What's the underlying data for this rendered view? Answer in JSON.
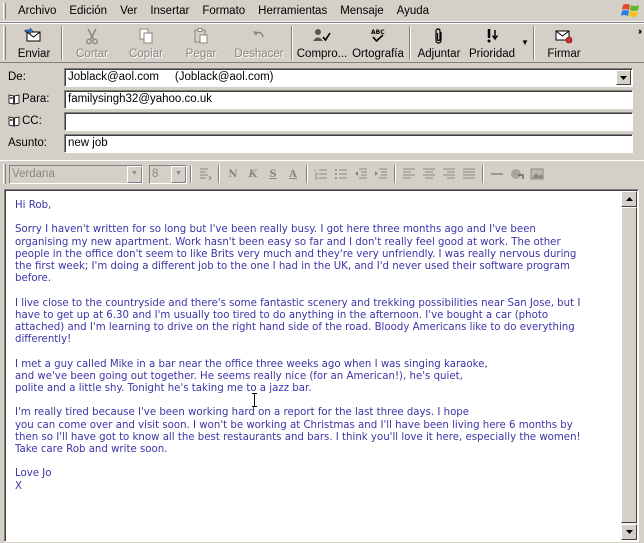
{
  "menubar": {
    "items": [
      "Archivo",
      "Edición",
      "Ver",
      "Insertar",
      "Formato",
      "Herramientas",
      "Mensaje",
      "Ayuda"
    ]
  },
  "toolbar": {
    "buttons": [
      {
        "label": "Enviar",
        "icon": "send-icon",
        "enabled": true
      },
      {
        "label": "Cortar",
        "icon": "scissors-icon",
        "enabled": false
      },
      {
        "label": "Copiar",
        "icon": "copy-icon",
        "enabled": false
      },
      {
        "label": "Pegar",
        "icon": "paste-icon",
        "enabled": false
      },
      {
        "label": "Deshacer",
        "icon": "undo-icon",
        "enabled": false
      },
      {
        "label": "Compro...",
        "icon": "check-names-icon",
        "enabled": true
      },
      {
        "label": "Ortografía",
        "icon": "spelling-icon",
        "enabled": true
      },
      {
        "label": "Adjuntar",
        "icon": "paperclip-icon",
        "enabled": true
      },
      {
        "label": "Prioridad",
        "icon": "priority-icon",
        "enabled": true
      },
      {
        "label": "Firmar",
        "icon": "sign-icon",
        "enabled": true
      }
    ]
  },
  "headers": {
    "from_label": "De:",
    "from_value": "Joblack@aol.com     (Joblack@aol.com)",
    "to_label": "Para:",
    "to_value": "familysingh32@yahoo.co.uk",
    "cc_label": "CC:",
    "cc_value": "",
    "subject_label": "Asunto:",
    "subject_value": "new job"
  },
  "format_bar": {
    "font": "Verdana",
    "size": "8"
  },
  "message": {
    "greeting": "Hi Rob,",
    "paragraphs": [
      [
        "Sorry I haven't written for so long but I've been really busy. I got here three months ago and I've been",
        "organising my new apartment. Work hasn't been easy so far and I don't really feel good at work. The other",
        "people in the office don't seem to like Brits very much and they're very unfriendly. I was really nervous during",
        "the first week; I'm doing a different job to the one I had in the UK, and I'd never used their software program",
        "before."
      ],
      [
        "I live close to the countryside and there's some fantastic scenery and trekking possibilities near San Jose, but I",
        "have to get up at 6.30 and I'm usually too tired to do anything in the afternoon. I've bought a car (photo",
        "attached) and I'm learning to drive on the right hand side of the road. Bloody Americans like to do everything",
        "differently!"
      ],
      [
        "I met a guy called Mike in a bar near the office three weeks ago when I was singing karaoke,",
        "and we've been going out together. He seems really nice (for an American!), he's quiet,",
        "polite and a little shy. Tonight he's taking me to a jazz bar."
      ],
      [
        "I'm really tired because I've been working hard on a report for the last three days. I hope",
        "you can come over and visit soon. I won't be working at Christmas and I'll have been living here 6 months by",
        "then so I'll have got to know all the best restaurants and bars. I think you'll love it here, especially the women!",
        "Take care Rob and write soon."
      ]
    ],
    "signoff": [
      "Love Jo",
      "X"
    ]
  },
  "colors": {
    "chrome": "#d4d0c8",
    "body_text": "#3a36a8",
    "disabled_text": "#8a8780"
  }
}
